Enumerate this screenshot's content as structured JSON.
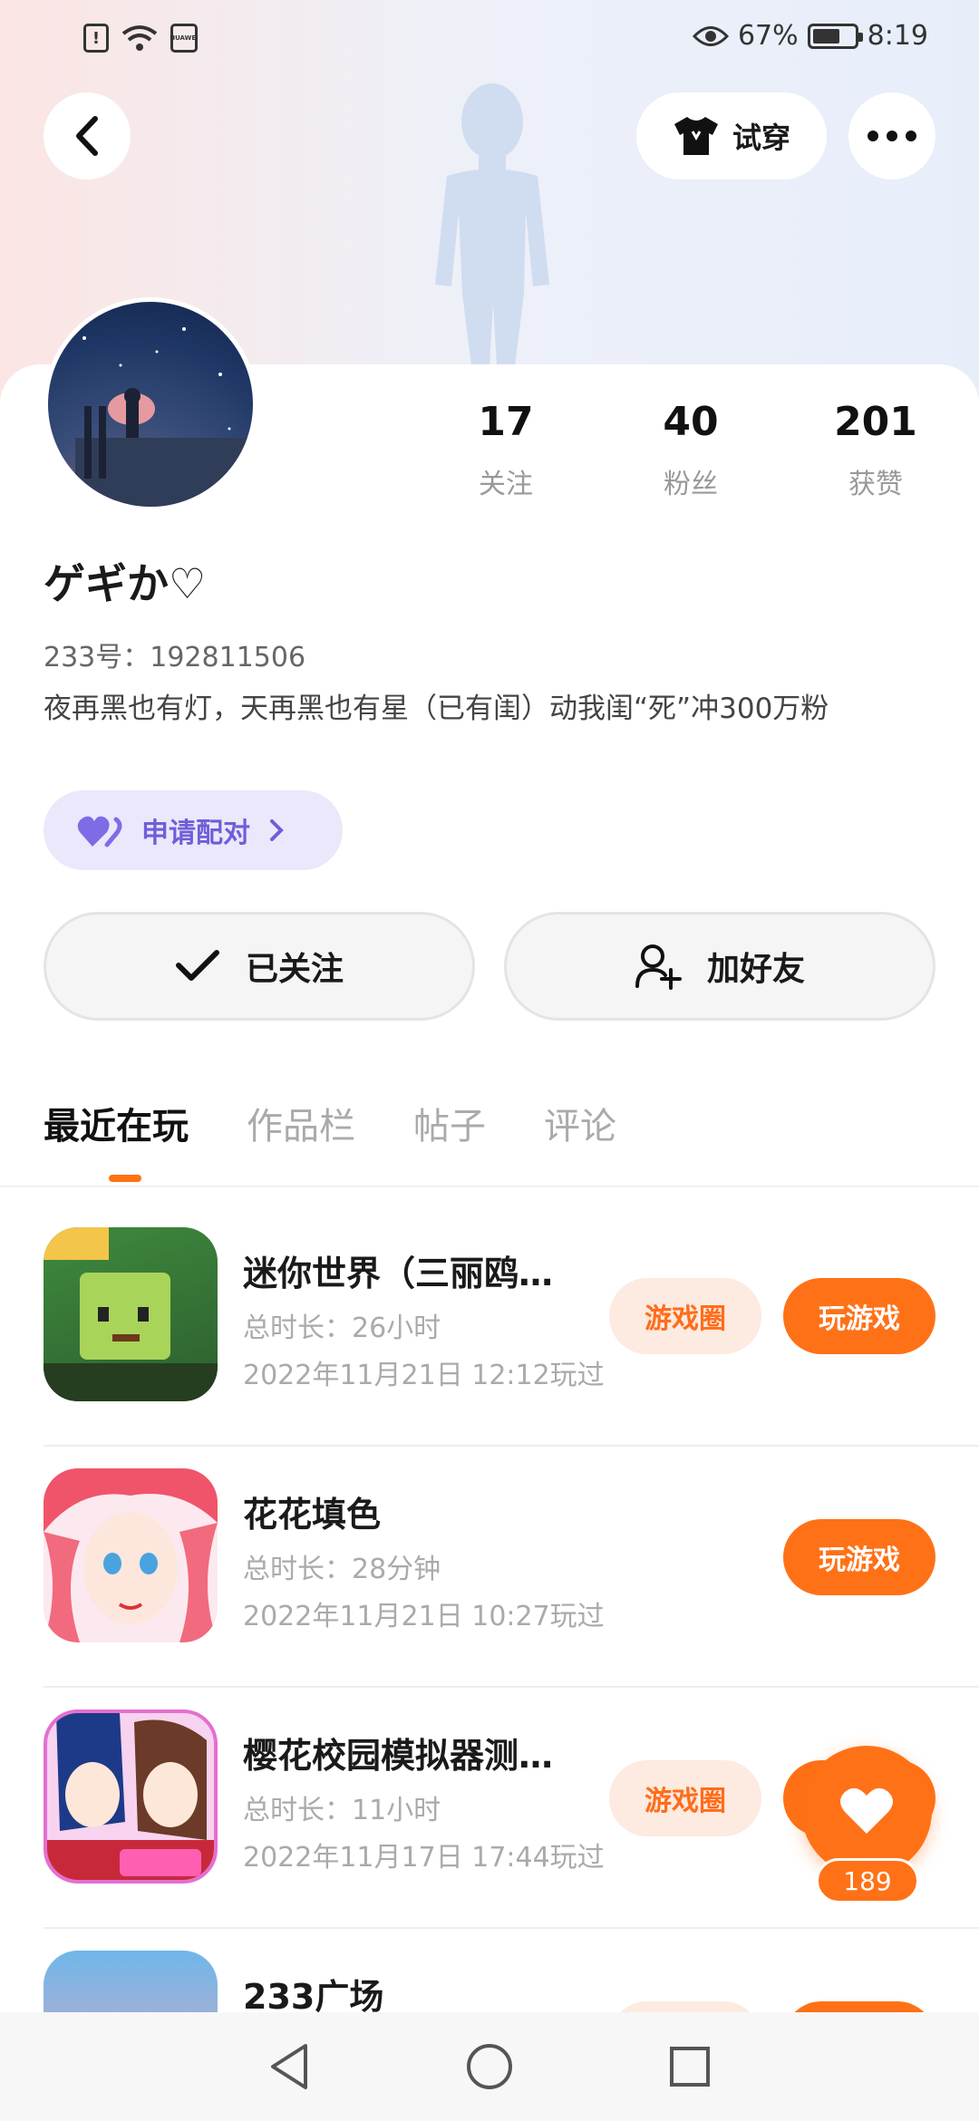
{
  "status_bar": {
    "battery_percent": "67%",
    "time": "8:19",
    "carrier": "HUAWEI"
  },
  "header": {
    "try_on_label": "试穿"
  },
  "profile": {
    "nickname": "ゲギか♡",
    "uid": "233号：192811506",
    "bio": "夜再黑也有灯，天再黑也有星（已有闺）动我闺“死”冲300万粉",
    "pair_button_label": "申请配对",
    "stats": [
      {
        "value": "17",
        "label": "关注"
      },
      {
        "value": "40",
        "label": "粉丝"
      },
      {
        "value": "201",
        "label": "获赞"
      }
    ]
  },
  "actions": {
    "followed_label": "已关注",
    "add_friend_label": "加好友"
  },
  "tabs": [
    "最近在玩",
    "作品栏",
    "帖子",
    "评论"
  ],
  "games": [
    {
      "title": "迷你世界（三丽鸥…",
      "duration": "总时长：26小时",
      "last_played": "2022年11月21日 12:12玩过",
      "circle_label": "游戏圈",
      "play_label": "玩游戏"
    },
    {
      "title": "花花填色",
      "duration": "总时长：28分钟",
      "last_played": "2022年11月21日 10:27玩过",
      "play_label": "玩游戏"
    },
    {
      "title": "樱花校园模拟器测…",
      "duration": "总时长：11小时",
      "last_played": "2022年11月17日 17:44玩过",
      "circle_label": "游戏圈",
      "play_label": "玩游戏"
    },
    {
      "title": "233广场"
    }
  ],
  "like_fab": {
    "count": "189"
  },
  "colors": {
    "accent": "#ff7117",
    "accent_soft": "#fdeae0",
    "pair_bg": "#ebe8fb",
    "pair_fg": "#6e5fd8"
  }
}
